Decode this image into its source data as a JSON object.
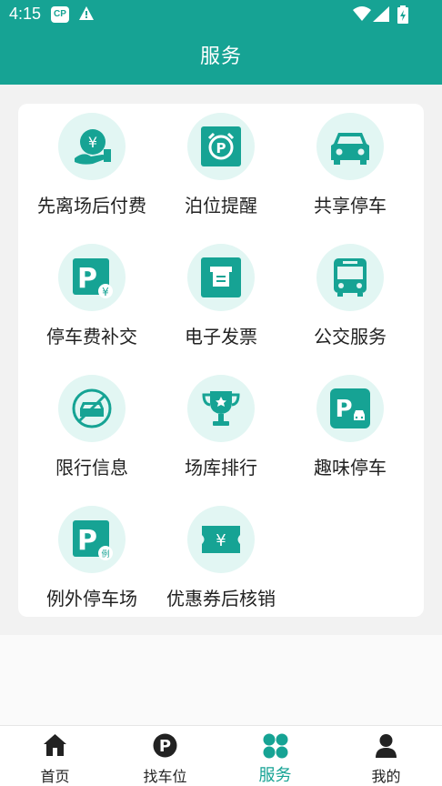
{
  "status_bar": {
    "time": "4:15",
    "app_badge": "CP"
  },
  "header": {
    "title": "服务"
  },
  "colors": {
    "primary": "#16a394",
    "icon_bg": "#e2f6f3"
  },
  "services": [
    {
      "label": "先离场后付费",
      "icon": "pay-later-icon"
    },
    {
      "label": "泊位提醒",
      "icon": "parking-alarm-icon"
    },
    {
      "label": "共享停车",
      "icon": "car-icon"
    },
    {
      "label": "停车费补交",
      "icon": "parking-fee-icon"
    },
    {
      "label": "电子发票",
      "icon": "invoice-icon"
    },
    {
      "label": "公交服务",
      "icon": "bus-icon"
    },
    {
      "label": "限行信息",
      "icon": "restricted-car-icon"
    },
    {
      "label": "场库排行",
      "icon": "trophy-icon"
    },
    {
      "label": "趣味停车",
      "icon": "fun-parking-icon"
    },
    {
      "label": "例外停车场",
      "icon": "exception-parking-icon"
    },
    {
      "label": "优惠券后核销",
      "icon": "coupon-icon"
    }
  ],
  "bottom_nav": [
    {
      "label": "首页",
      "icon": "home-icon",
      "active": false
    },
    {
      "label": "找车位",
      "icon": "parking-p-icon",
      "active": false
    },
    {
      "label": "服务",
      "icon": "services-icon",
      "active": true
    },
    {
      "label": "我的",
      "icon": "person-icon",
      "active": false
    }
  ]
}
